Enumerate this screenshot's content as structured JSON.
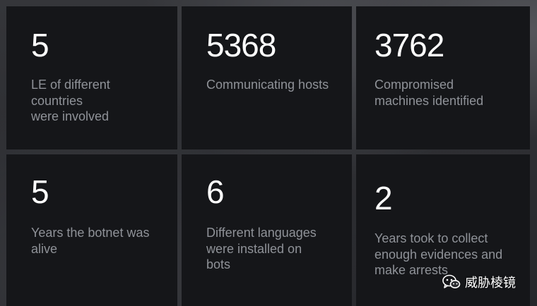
{
  "stats": [
    {
      "value": "5",
      "label": "LE of different\ncountries\nwere involved"
    },
    {
      "value": "5368",
      "label": "Communicating hosts"
    },
    {
      "value": "3762",
      "label": "Compromised\nmachines identified"
    },
    {
      "value": "5",
      "label": "Years the botnet was\nalive"
    },
    {
      "value": "6",
      "label": "Different languages\nwere installed on\nbots"
    },
    {
      "value": "2",
      "label": "Years took to collect\nenough evidences and\nmake arrests"
    }
  ],
  "watermark": {
    "icon": "wechat-icon",
    "text": "威胁棱镜"
  },
  "colors": {
    "card_background": "#151619",
    "value_text": "#ffffff",
    "label_text": "#8f9298"
  }
}
